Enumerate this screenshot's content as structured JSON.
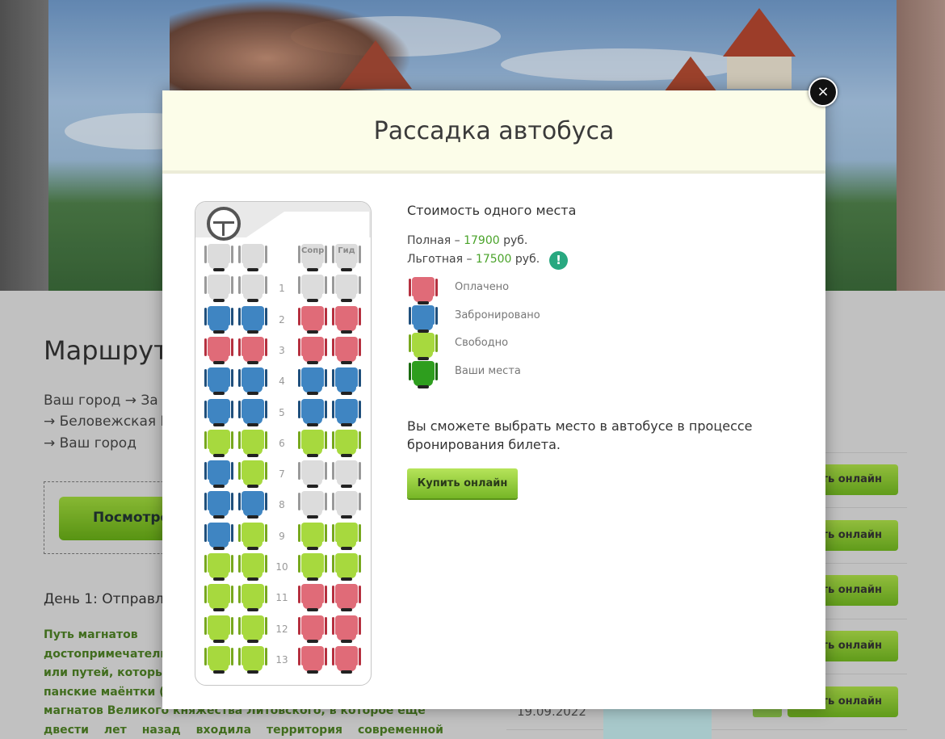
{
  "background": {
    "route_title": "Маршрут",
    "route_lines": [
      "Ваш город  →  За",
      "→  Беловежская П",
      "→  Ваш город"
    ],
    "cta_label": "Посмотре",
    "day_title": "День 1: Отправл",
    "description_lines": [
      "Путь магнатов",
      "достопримечательн",
      "или путей, которые",
      "панские маёнтки (у",
      "магнатов Великого княжества Литовского, в которое еще",
      "двести лет назад входила территория современной Беларусии."
    ],
    "side_button_label": "пить онлайн",
    "date": "19.09.2022"
  },
  "modal": {
    "title": "Рассадка автобуса",
    "close_symbol": "×",
    "cost_title": "Стоимость одного места",
    "full_label": "Полная – ",
    "full_price": "17900",
    "reduced_label": "Льготная – ",
    "reduced_price": "17500",
    "currency": " руб.",
    "info_symbol": "!",
    "legend": [
      {
        "status": "red",
        "label": "Оплачено"
      },
      {
        "status": "blue",
        "label": "Забронировано"
      },
      {
        "status": "green",
        "label": "Свободно"
      },
      {
        "status": "dark",
        "label": "Ваши места"
      }
    ],
    "note": "Вы сможете выбрать место в автобусе в процессе бронирования билета.",
    "buy_label": "Купить онлайн"
  },
  "bus": {
    "wheel_icon": "steering-wheel-icon",
    "front_row": {
      "left": [
        "grey",
        "grey"
      ],
      "right_labels": [
        "Сопр",
        "Гид"
      ]
    },
    "rows": [
      {
        "num": "1",
        "seats": [
          "grey",
          "grey",
          "grey",
          "grey"
        ]
      },
      {
        "num": "2",
        "seats": [
          "blue",
          "blue",
          "red",
          "red"
        ]
      },
      {
        "num": "3",
        "seats": [
          "red",
          "red",
          "red",
          "red"
        ]
      },
      {
        "num": "4",
        "seats": [
          "blue",
          "blue",
          "blue",
          "blue"
        ]
      },
      {
        "num": "5",
        "seats": [
          "blue",
          "blue",
          "blue",
          "blue"
        ]
      },
      {
        "num": "6",
        "seats": [
          "green",
          "green",
          "green",
          "green"
        ]
      },
      {
        "num": "7",
        "seats": [
          "blue",
          "green",
          "grey",
          "grey"
        ]
      },
      {
        "num": "8",
        "seats": [
          "blue",
          "blue",
          "grey",
          "grey"
        ]
      },
      {
        "num": "9",
        "seats": [
          "blue",
          "green",
          "green",
          "green"
        ]
      },
      {
        "num": "10",
        "seats": [
          "green",
          "green",
          "green",
          "green"
        ]
      },
      {
        "num": "11",
        "seats": [
          "green",
          "green",
          "red",
          "red"
        ]
      },
      {
        "num": "12",
        "seats": [
          "green",
          "green",
          "red",
          "red"
        ]
      },
      {
        "num": "13",
        "seats": [
          "green",
          "green",
          "red",
          "red"
        ]
      }
    ]
  },
  "colors": {
    "accent_green": "#4aa32a",
    "paid": "#e06b78",
    "booked": "#3f85c2",
    "free": "#a7d93e",
    "yours": "#2e9e1e"
  }
}
